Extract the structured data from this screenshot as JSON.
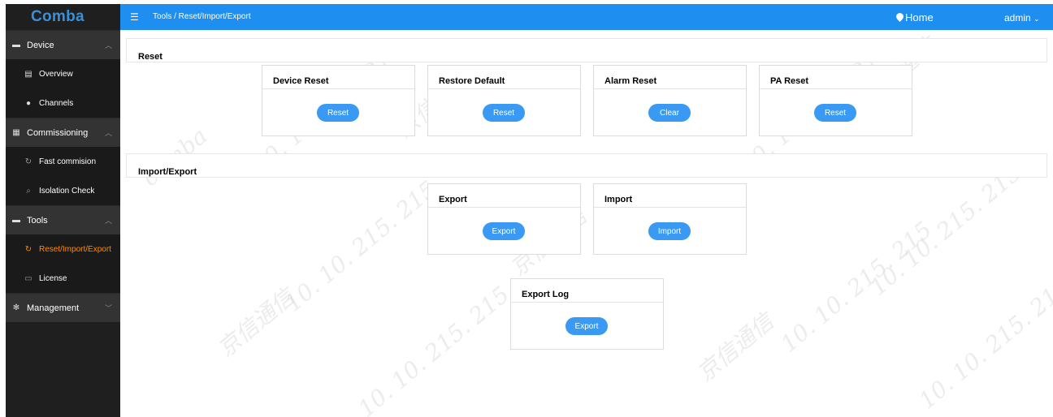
{
  "app": {
    "logo": "Comba"
  },
  "header": {
    "breadcrumb": "Tools / Reset/Import/Export",
    "home_label": "Home",
    "user_label": "admin"
  },
  "sidebar": {
    "device": {
      "label": "Device",
      "items": [
        {
          "label": "Overview"
        },
        {
          "label": "Channels"
        }
      ]
    },
    "commissioning": {
      "label": "Commissioning",
      "items": [
        {
          "label": "Fast commision"
        },
        {
          "label": "Isolation Check"
        }
      ]
    },
    "tools": {
      "label": "Tools",
      "items": [
        {
          "label": "Reset/Import/Export"
        },
        {
          "label": "License"
        }
      ]
    },
    "management": {
      "label": "Management"
    }
  },
  "sections": {
    "reset": {
      "title": "Reset",
      "cards": [
        {
          "title": "Device Reset",
          "button": "Reset"
        },
        {
          "title": "Restore Default",
          "button": "Reset"
        },
        {
          "title": "Alarm Reset",
          "button": "Clear"
        },
        {
          "title": "PA Reset",
          "button": "Reset"
        }
      ]
    },
    "import_export": {
      "title": "Import/Export",
      "cards": [
        {
          "title": "Export",
          "button": "Export"
        },
        {
          "title": "Import",
          "button": "Import"
        }
      ]
    },
    "export_log": {
      "title": "Export Log",
      "button": "Export"
    }
  },
  "watermark": {
    "text_cn": "京信通信",
    "text_brand": "comba",
    "text_ip": "10. 10. 215. 215"
  },
  "colors": {
    "header": "#1e8ff1",
    "sidebar": "#1f1f1f",
    "active": "#ff8a00",
    "button": "#3a99f2",
    "logo": "#3a8fd6"
  }
}
